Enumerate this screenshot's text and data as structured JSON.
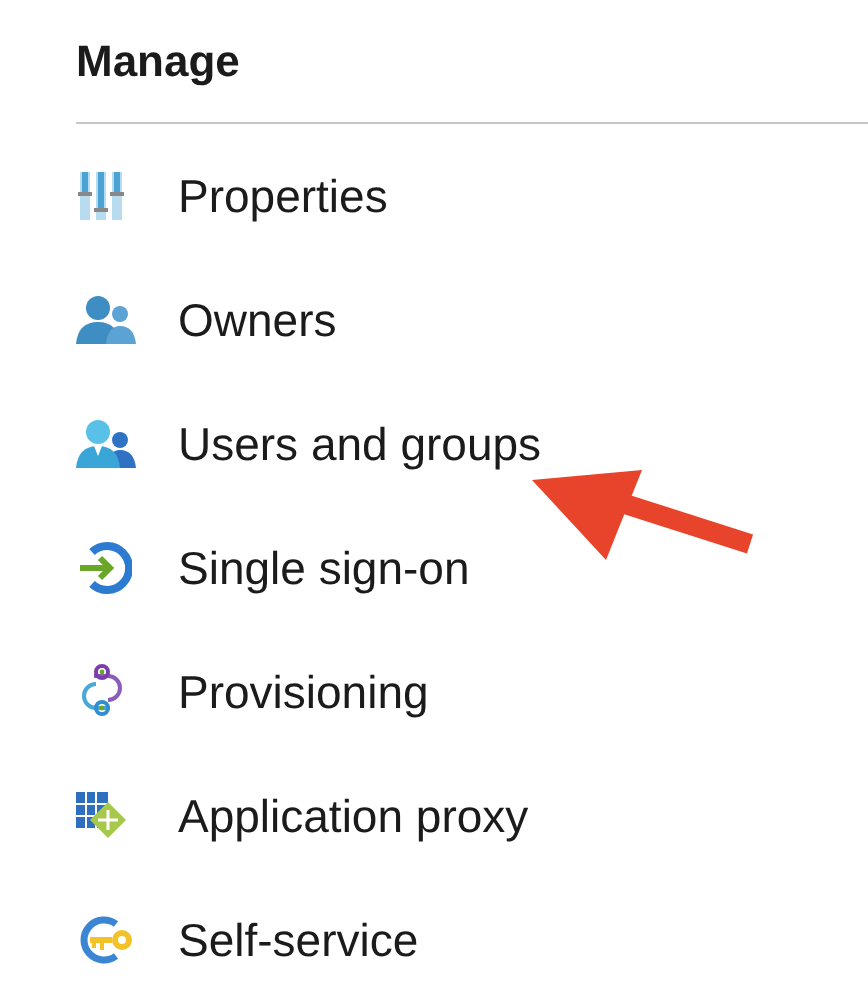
{
  "section": {
    "title": "Manage"
  },
  "items": [
    {
      "label": "Properties",
      "kind": "sliders"
    },
    {
      "label": "Owners",
      "kind": "people"
    },
    {
      "label": "Users and groups",
      "kind": "users"
    },
    {
      "label": "Single sign-on",
      "kind": "signin"
    },
    {
      "label": "Provisioning",
      "kind": "sync"
    },
    {
      "label": "Application proxy",
      "kind": "grid"
    },
    {
      "label": "Self-service",
      "kind": "key"
    }
  ]
}
